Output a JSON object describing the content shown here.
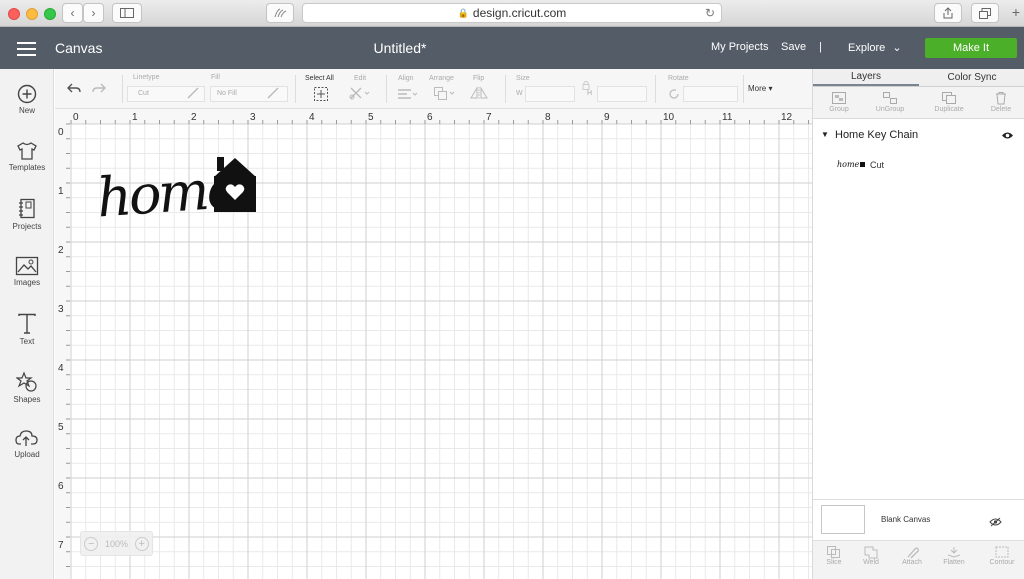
{
  "browser": {
    "url": "design.cricut.com",
    "icons": [
      "back-icon",
      "forward-icon",
      "sidebar-icon",
      "reader-icon",
      "lock-icon",
      "reload-icon",
      "share-icon",
      "tabs-icon",
      "new-tab-icon"
    ]
  },
  "header": {
    "app_title": "Canvas",
    "doc_title": "Untitled*",
    "my_projects": "My Projects",
    "save": "Save",
    "separator": "|",
    "explore": "Explore",
    "make_it": "Make It",
    "make_it_color": "#4caf2a",
    "header_color": "#545c67"
  },
  "sidebar": {
    "items": [
      {
        "label": "New",
        "icon": "plus-circle-icon"
      },
      {
        "label": "Templates",
        "icon": "tshirt-icon"
      },
      {
        "label": "Projects",
        "icon": "notebook-icon"
      },
      {
        "label": "Images",
        "icon": "image-icon"
      },
      {
        "label": "Text",
        "icon": "text-icon"
      },
      {
        "label": "Shapes",
        "icon": "shapes-icon"
      },
      {
        "label": "Upload",
        "icon": "cloud-upload-icon"
      }
    ]
  },
  "toolbar": {
    "linetype_label": "Linetype",
    "linetype_value": "Cut",
    "fill_label": "Fill",
    "fill_value": "No Fill",
    "select_all": "Select All",
    "edit": "Edit",
    "align": "Align",
    "arrange": "Arrange",
    "flip": "Flip",
    "size": "Size",
    "w": "W",
    "h": "H",
    "rotate": "Rotate",
    "more": "More"
  },
  "canvas": {
    "ruler_x": [
      "0",
      "1",
      "2",
      "3",
      "4",
      "5",
      "6",
      "7",
      "8",
      "9",
      "10",
      "11",
      "12"
    ],
    "ruler_y": [
      "0",
      "1",
      "2",
      "3",
      "4",
      "5",
      "6",
      "7"
    ],
    "design_text": "home",
    "zoom": "100%"
  },
  "panel": {
    "tabs": [
      "Layers",
      "Color Sync"
    ],
    "actions": [
      "Group",
      "UnGroup",
      "Duplicate",
      "Delete"
    ],
    "layer_group_name": "Home Key Chain",
    "layer_item_label": "Cut",
    "layer_thumb_text": "home",
    "blank_canvas": "Blank Canvas",
    "bottom_actions": [
      "Slice",
      "Weld",
      "Attach",
      "Flatten",
      "Contour"
    ]
  }
}
